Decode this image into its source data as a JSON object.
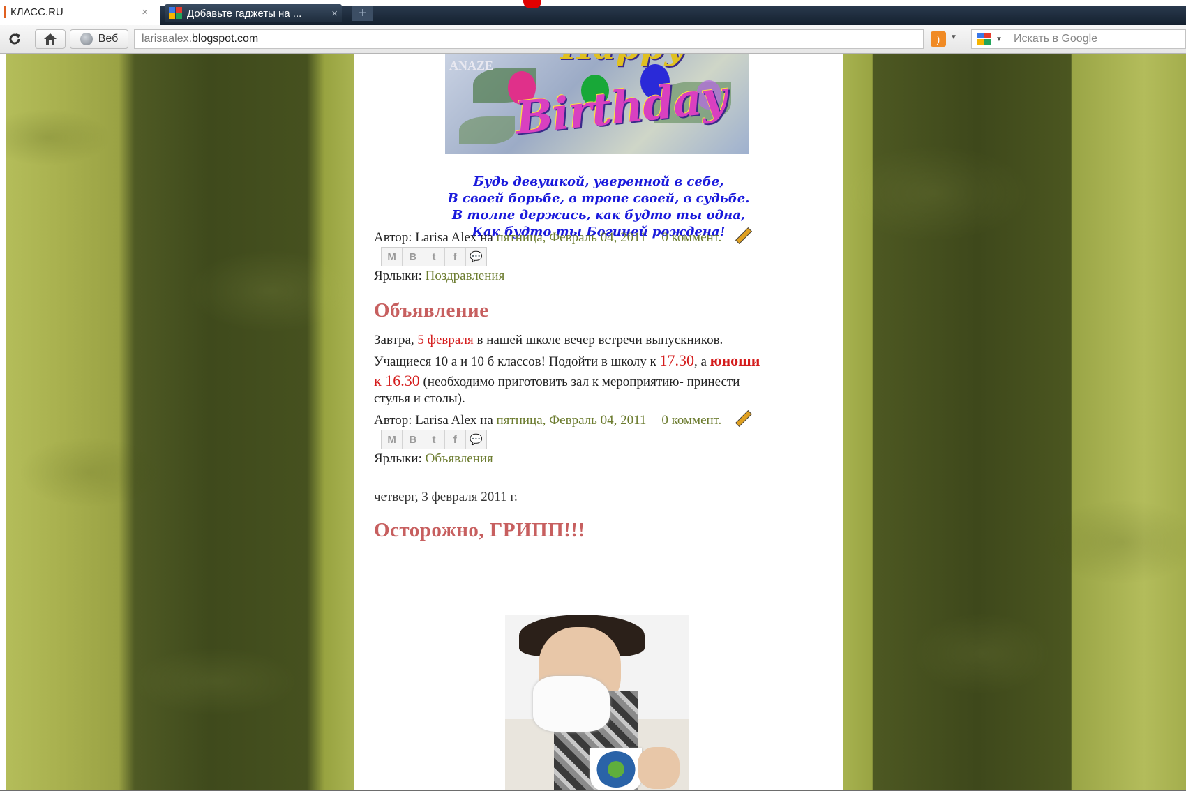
{
  "browser": {
    "tabs": [
      {
        "label": "КЛАСС.RU",
        "active": false
      },
      {
        "label": "Добавьте гаджеты на ...",
        "active": true
      }
    ],
    "close_glyph": "×",
    "new_tab_glyph": "+",
    "toolbar": {
      "web_label": "Веб",
      "url_host_prefix": "larisaalex.",
      "url_domain": "blogspot.com",
      "search_placeholder": "Искать в Google"
    },
    "icons": [
      "reload-icon",
      "home-icon",
      "globe-icon",
      "rss-icon",
      "google-icon"
    ]
  },
  "posts": [
    {
      "image": {
        "name": "happy-birthday-image",
        "top_text": "Happy",
        "main_text": "Birthday",
        "side_text": "ANAZE"
      },
      "poem": [
        "Будь девушкой, уверенной в себе,",
        "В своей борьбе, в тропе своей, в судьбе.",
        "В толпе держись, как будто ты одна,",
        "Как будто ты Богиней рождена!"
      ],
      "meta": {
        "author_prefix": "Автор: Larisa Alex на",
        "date": "пятница, Февраль 04, 2011",
        "comments": "0 коммент."
      },
      "labels_prefix": "Ярлыки:",
      "labels": "Поздравления"
    },
    {
      "title": "Объявление",
      "body": {
        "p1_a": "Завтра, ",
        "p1_red": "5 февраля",
        "p1_b": " в нашей школе вечер встречи выпускников.",
        "p2_a": "Учащиеся 10 а и 10 б классов!  Подойти в школу к ",
        "p2_red": "17.30",
        "p2_b": ", а ",
        "p2_bold": "юноши",
        "p3_red": "к 16.30",
        "p3_b": " (необходимо приготовить зал к мероприятию- принести",
        "p4": "стулья и столы)."
      },
      "meta": {
        "author_prefix": "Автор: Larisa Alex на",
        "date": "пятница, Февраль 04, 2011",
        "comments": "0 коммент."
      },
      "labels_prefix": "Ярлыки:",
      "labels": "Объявления"
    },
    {
      "date_header": "четверг, 3 февраля 2011 г.",
      "title": "Осторожно, ГРИПП!!!",
      "image": {
        "name": "flu-woman-image"
      }
    }
  ],
  "share_buttons": [
    "M",
    "B",
    "t",
    "f",
    "💬"
  ],
  "colors": {
    "link": "#6b7b2e",
    "title": "#c75f5f",
    "poem": "#1a1adc",
    "highlight": "#d41c1c",
    "stripe_light": "#a9b352",
    "stripe_dark": "#3f4a1c"
  }
}
